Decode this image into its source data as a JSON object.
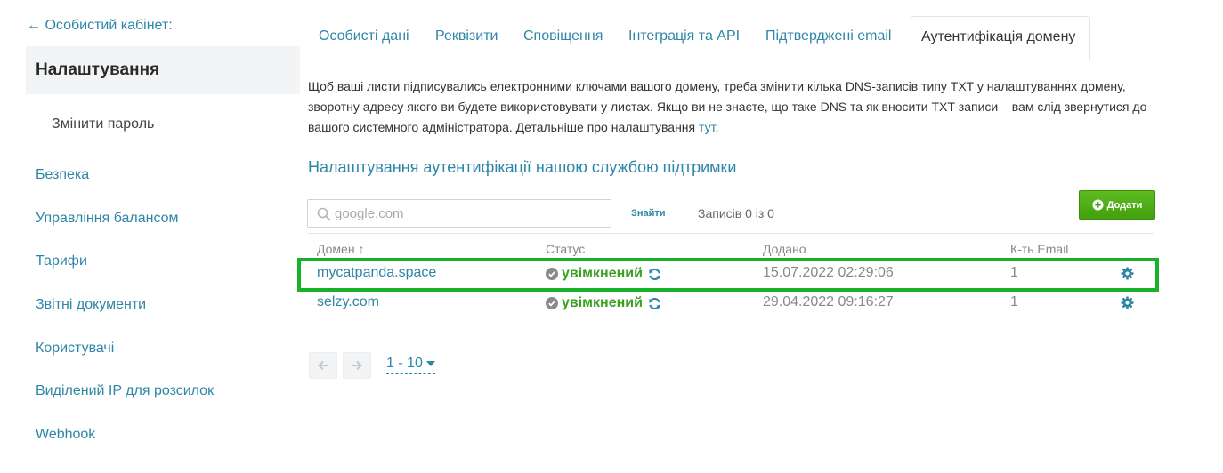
{
  "sidebar": {
    "back_label": "← Особистий кабінет:",
    "active_label": "Налаштування",
    "sub_item": "Змінити пароль",
    "items": [
      {
        "label": "Безпека"
      },
      {
        "label": "Управління балансом"
      },
      {
        "label": "Тарифи"
      },
      {
        "label": "Звітні документи"
      },
      {
        "label": "Користувачі"
      },
      {
        "label": "Виділений IP для розсилок"
      },
      {
        "label": "Webhook"
      }
    ]
  },
  "tabs": [
    {
      "label": "Особисті дані"
    },
    {
      "label": "Реквізити"
    },
    {
      "label": "Сповіщення"
    },
    {
      "label": "Інтеграція та API"
    },
    {
      "label": "Підтверджені email"
    },
    {
      "label": "Аутентифікація домену",
      "active": true
    }
  ],
  "description": {
    "text": "Щоб ваші листи підписувались електронними ключами вашого домену, треба змінити кілька DNS-записів типу TXT у налаштуваннях домену, зворотну адресу якого ви будете використовувати у листах. Якщо ви не знаєте, що таке DNS та як вносити TXT-записи – вам слід звернутися до вашого системного адміністратора. Детальніше про налаштування ",
    "link": "тут",
    "end": "."
  },
  "section_title": "Налаштування аутентифікації нашою службою підтримки",
  "toolbar": {
    "search_placeholder": "google.com",
    "search_value": "",
    "find_label": "Знайти",
    "records_label": "Записів 0 із 0",
    "add_label": "Додати"
  },
  "table": {
    "columns": {
      "domain": "Домен ↑",
      "status": "Статус",
      "added": "Додано",
      "count": "К-ть Email"
    },
    "rows": [
      {
        "domain": "mycatpanda.space",
        "status": "увімкнений",
        "added": "15.07.2022 02:29:06",
        "count": "1"
      },
      {
        "domain": "selzy.com",
        "status": "увімкнений",
        "added": "29.04.2022 09:16:27",
        "count": "1"
      }
    ]
  },
  "pagination": {
    "page_size_label": "1 - 10"
  },
  "colors": {
    "accent": "#2e86a6",
    "success": "#3aa01e",
    "add_button": "#4caf1a",
    "highlight_border": "#18b12a"
  }
}
